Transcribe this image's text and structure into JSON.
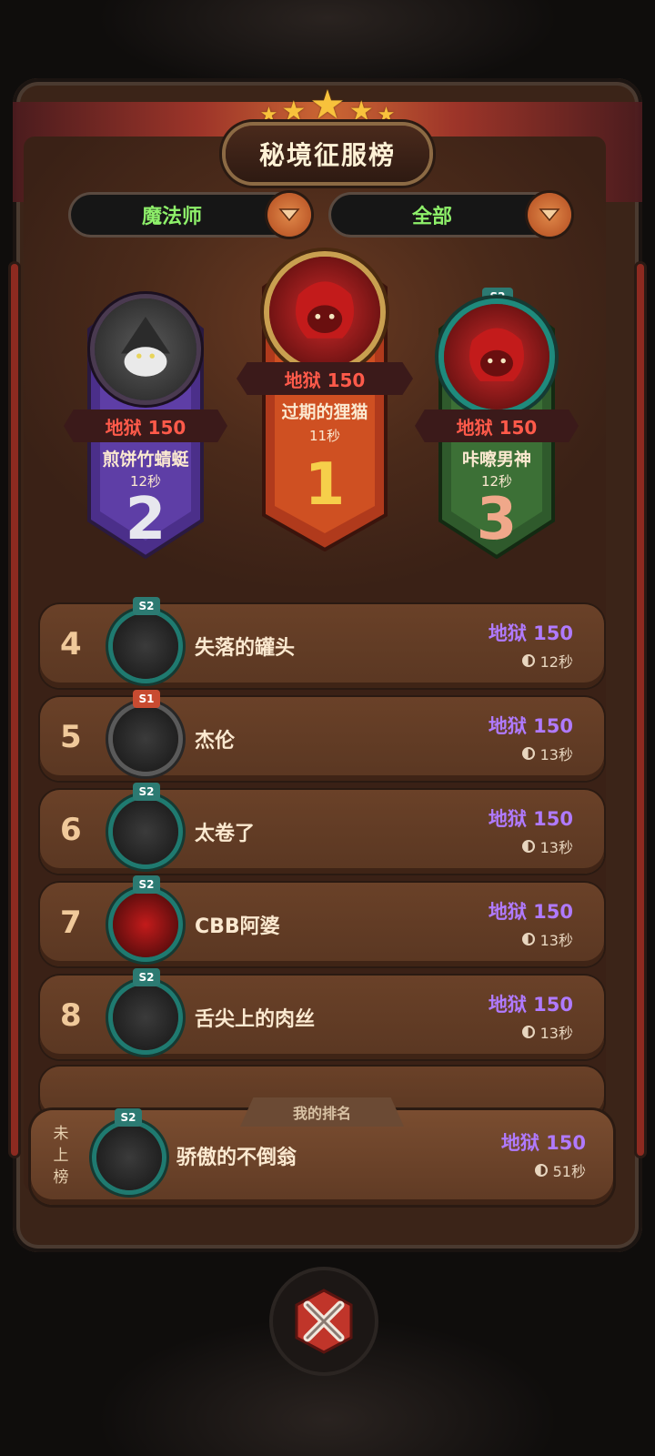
{
  "header": {
    "title": "秘境征服榜",
    "stars": 5
  },
  "filters": {
    "class_label": "魔法师",
    "scope_label": "全部"
  },
  "podium": [
    {
      "rank": "1",
      "name": "过期的狸猫",
      "score": "地狱 150",
      "time": "11秒"
    },
    {
      "rank": "2",
      "name": "煎饼竹蜻蜓",
      "score": "地狱 150",
      "time": "12秒"
    },
    {
      "rank": "3",
      "name": "咔嚓男神",
      "score": "地狱 150",
      "time": "12秒",
      "season": "S2"
    }
  ],
  "list": [
    {
      "rank": "4",
      "name": "失落的罐头",
      "score": "地狱 150",
      "time": "12秒",
      "season": "S2"
    },
    {
      "rank": "5",
      "name": "杰伦",
      "score": "地狱 150",
      "time": "13秒",
      "season": "S1"
    },
    {
      "rank": "6",
      "name": "太卷了",
      "score": "地狱 150",
      "time": "13秒",
      "season": "S2"
    },
    {
      "rank": "7",
      "name": "CBB阿婆",
      "score": "地狱 150",
      "time": "13秒",
      "season": "S2"
    },
    {
      "rank": "8",
      "name": "舌尖上的肉丝",
      "score": "地狱 150",
      "time": "13秒",
      "season": "S2"
    }
  ],
  "my_rank": {
    "tab_label": "我的排名",
    "status": "未上榜",
    "name": "骄傲的不倒翁",
    "score": "地狱 150",
    "time": "51秒",
    "season": "S2"
  },
  "colors": {
    "score_purple": "#b07aff",
    "filter_green": "#8ef06a",
    "hell_red": "#ff5a4a"
  },
  "icons": {
    "dropdown": "chevron-down-icon",
    "close": "close-icon",
    "clock": "clock-icon"
  }
}
